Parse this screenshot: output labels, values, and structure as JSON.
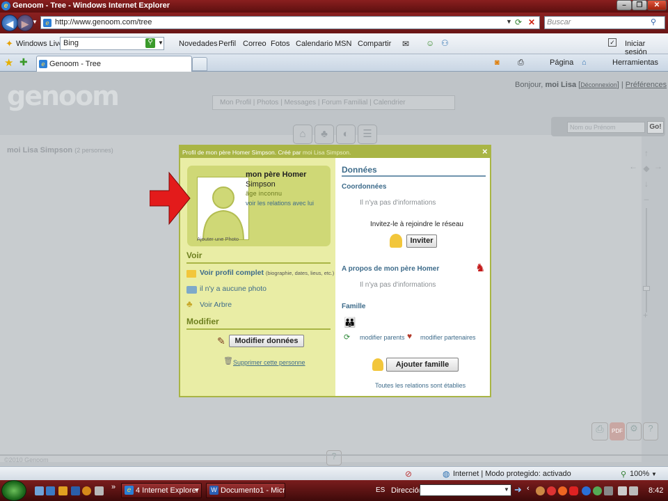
{
  "window": {
    "title": "Genoom - Tree - Windows Internet Explorer"
  },
  "addressbar": {
    "url": "http://www.genoom.com/tree",
    "search_placeholder": "Buscar"
  },
  "links_toolbar": {
    "windows_live": "Windows Live",
    "search_value": "Bing",
    "links": [
      "Novedades",
      "Perfil",
      "Correo",
      "Fotos",
      "Calendario",
      "MSN",
      "Compartir"
    ],
    "signin": "Iniciar sesión"
  },
  "tabs": {
    "active_tab": "Genoom - Tree",
    "page_cmd": "Página",
    "tools_cmd": "Herramientas"
  },
  "site": {
    "logo": "genoom",
    "greeting_prefix": "Bonjour,",
    "user": "moi Lisa",
    "logout": "Déconnexion",
    "prefs": "Préférences",
    "nav": [
      "Mon Profil",
      "Photos",
      "Messages",
      "Forum Familial",
      "Calendrier"
    ],
    "search_placeholder": "Nom ou Prénom",
    "go": "Go!",
    "person_title": "moi Lisa Simpson",
    "person_count": "(2 personnes)",
    "copyright": "©2010 Genoom"
  },
  "modal": {
    "header_text": "Profil de mon père Homer Simpson. Créé par",
    "header_author": "moi Lisa Simpson.",
    "close": "×",
    "name_line1": "mon père Homer",
    "name_line2": "Simpson",
    "age": "âge inconnu",
    "relations_link": "voir les relations avec lui",
    "add_photo": "Ajouter une Photo",
    "voir_title": "Voir",
    "voir_profil": "Voir profil complet",
    "voir_profil_note": "(biographie, dates, lieus, etc.)",
    "no_photo": "il n'y a aucune photo",
    "voir_arbre": "Voir Arbre",
    "modifier_title": "Modifier",
    "modifier_btn": "Modifier données",
    "supprimer": "Supprimer cette personne",
    "donnees_title": "Données",
    "coord_title": "Coordonnées",
    "no_info1": "Il n'ya pas d'informations",
    "invite_text": "Invitez-le à rejoindre le réseau",
    "invite_btn": "Inviter",
    "apropos_title": "A propos de mon père Homer",
    "no_info2": "Il n'ya pas d'informations",
    "famille_title": "Famille",
    "mod_parents": "modifier parents",
    "mod_partners": "modifier partenaires",
    "add_family_btn": "Ajouter famille",
    "all_relations": "Toutes les relations sont établies"
  },
  "statusbar": {
    "zone": "Internet | Modo protegido: activado",
    "zoom": "100%"
  },
  "taskbar": {
    "ie_task": "4 Internet Explorer",
    "word_task": "Documento1 - Micr...",
    "lang": "ES",
    "dir_label": "Dirección",
    "clock": "8:42"
  },
  "colors": {
    "accent": "#a9b545",
    "titlebar": "#6b1414",
    "arrow": "#e31b1b"
  }
}
